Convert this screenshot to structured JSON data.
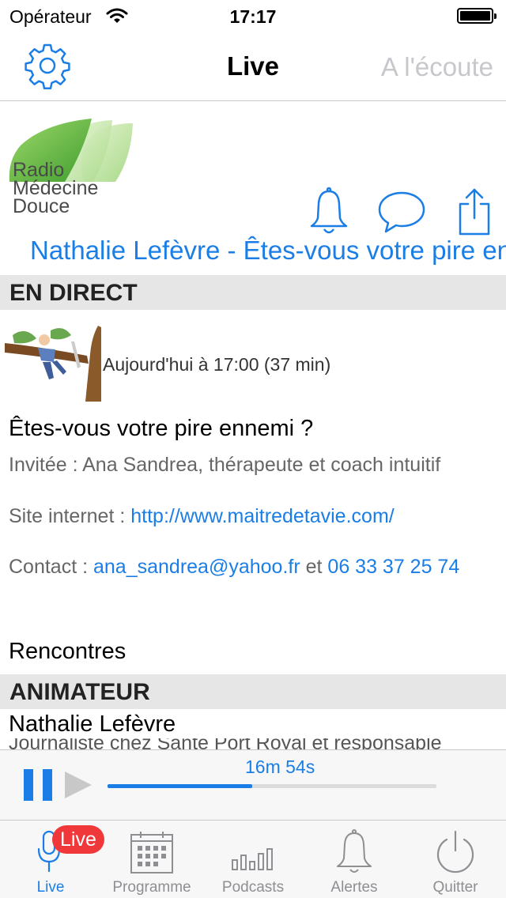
{
  "status_bar": {
    "carrier": "Opérateur",
    "time": "17:17",
    "wifi_icon": "wifi-icon",
    "battery_icon": "battery-icon"
  },
  "nav": {
    "title": "Live",
    "right_label": "A l'écoute",
    "settings_icon": "gear-icon"
  },
  "logo": {
    "lines": [
      "Radio",
      "Médecine",
      "Douce"
    ]
  },
  "actions": {
    "icons": [
      "bell-icon",
      "chat-bubble-icon",
      "share-icon"
    ]
  },
  "now_playing_title": "Nathalie Lefèvre - Êtes-vous votre pire ennemi ?",
  "live_section": {
    "header": "EN DIRECT",
    "date": "Aujourd'hui à 17:00 (37 min)",
    "show_title": "Êtes-vous votre pire ennemi ?",
    "guest": "Invitée : Ana Sandrea, thérapeute et coach intuitif",
    "site_label": "Site internet : ",
    "site_url": "http://www.maitredetavie.com/",
    "contact_label": "Contact : ",
    "contact_email": "ana_sandrea@yahoo.fr",
    "contact_and": " et ",
    "contact_phone": "06 33 37 25 74",
    "category": "Rencontres"
  },
  "host_section": {
    "header": "ANIMATEUR",
    "name": "Nathalie Lefèvre",
    "description": "Journaliste chez Santé Port Royal et responsable"
  },
  "player": {
    "elapsed": "16m 54s",
    "progress": 0.44,
    "pause_icon": "pause-icon",
    "play_icon": "play-icon"
  },
  "tabs": [
    {
      "label": "Live",
      "icon": "microphone-icon",
      "active": true,
      "badge": "Live"
    },
    {
      "label": "Programme",
      "icon": "calendar-icon",
      "active": false
    },
    {
      "label": "Podcasts",
      "icon": "equalizer-icon",
      "active": false
    },
    {
      "label": "Alertes",
      "icon": "bell-icon",
      "active": false
    },
    {
      "label": "Quitter",
      "icon": "power-icon",
      "active": false
    }
  ],
  "colors": {
    "accent": "#1a7ee6",
    "badge": "#f0383a",
    "section_bg": "#e6e6e6",
    "inactive": "#8e8e93"
  }
}
